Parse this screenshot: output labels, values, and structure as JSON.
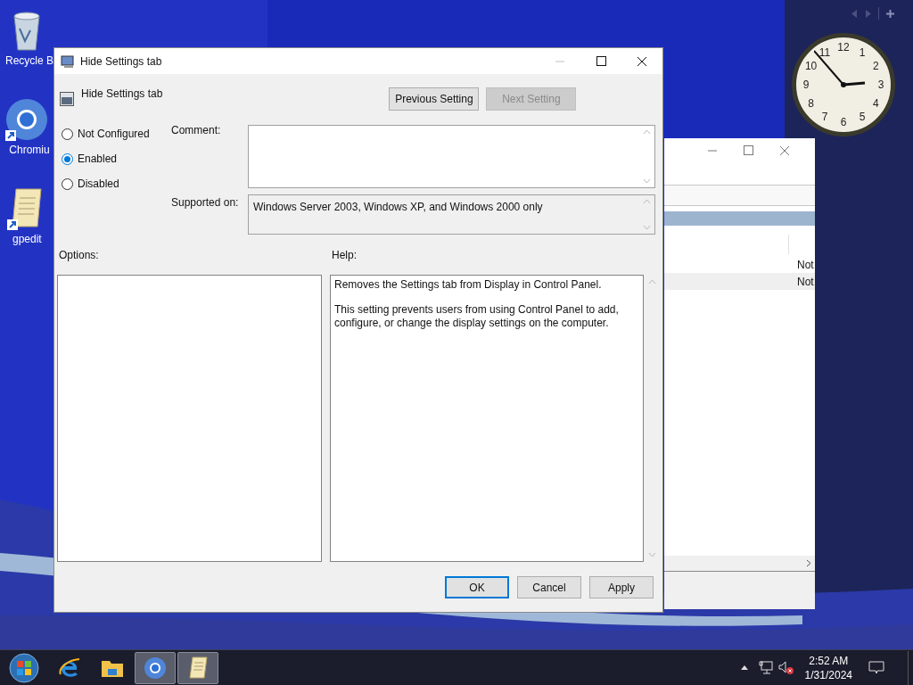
{
  "desktop_icons": [
    {
      "label": "Recycle B",
      "kind": "recycle"
    },
    {
      "label": "Chromiu",
      "kind": "chromium"
    },
    {
      "label": "gpedit",
      "kind": "script"
    }
  ],
  "clock_gadget": {
    "numerals": [
      "12",
      "1",
      "2",
      "3",
      "4",
      "5",
      "6",
      "7",
      "8",
      "9",
      "10",
      "11"
    ]
  },
  "background_window": {
    "cells": [
      "Not",
      "Not"
    ]
  },
  "dialog": {
    "title": "Hide Settings tab",
    "heading": "Hide Settings tab",
    "nav_buttons": [
      {
        "label": "Previous Setting",
        "disabled": false
      },
      {
        "label": "Next Setting",
        "disabled": true
      }
    ],
    "states": [
      {
        "label": "Not Configured",
        "selected": false
      },
      {
        "label": "Enabled",
        "selected": true
      },
      {
        "label": "Disabled",
        "selected": false
      }
    ],
    "comment_label": "Comment:",
    "supported_label": "Supported on:",
    "supported_value": "Windows Server 2003, Windows XP, and Windows 2000 only",
    "options_label": "Options:",
    "help_label": "Help:",
    "help_paragraphs": [
      "Removes the Settings tab from Display in Control Panel.",
      "This setting prevents users from using Control Panel to add, configure, or change the display settings on the computer."
    ],
    "buttons": [
      {
        "label": "OK",
        "default": true
      },
      {
        "label": "Cancel",
        "default": false
      },
      {
        "label": "Apply",
        "default": false
      }
    ]
  },
  "taskbar": {
    "apps": [
      {
        "kind": "ie",
        "running": false
      },
      {
        "kind": "explorer",
        "running": false
      },
      {
        "kind": "chromium",
        "running": true
      },
      {
        "kind": "script",
        "running": true
      }
    ],
    "time": "2:52 AM",
    "date": "1/31/2024"
  }
}
